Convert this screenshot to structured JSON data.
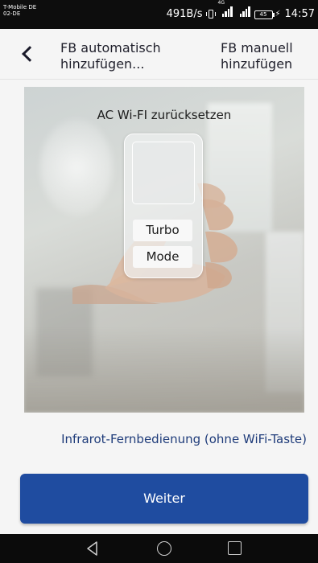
{
  "status_bar": {
    "carrier_line1": "T-Mobile DE",
    "carrier_line2": "02-DE",
    "network_speed": "491B/s",
    "network_type": "4G",
    "battery_level": "45",
    "time": "14:57",
    "icons": [
      "vibrate-icon",
      "signal-icon",
      "signal-icon",
      "battery-icon",
      "charging-icon"
    ]
  },
  "header": {
    "back_icon": "chevron-left-icon",
    "tab_auto_label": "FB automatisch hinzufügen...",
    "tab_manual_label": "FB manuell hinzufügen"
  },
  "illustration": {
    "title": "AC Wi-FI zurücksetzen",
    "remote_buttons": [
      "Turbo",
      "Mode"
    ]
  },
  "link": {
    "label": "Infrarot-Fernbedienung (ohne WiFi-Taste)"
  },
  "footer": {
    "continue_label": "Weiter"
  },
  "nav_bar": {
    "icons": [
      "nav-back-icon",
      "nav-home-icon",
      "nav-recent-icon"
    ]
  },
  "colors": {
    "primary": "#1f4ca0",
    "link": "#1f3c7a",
    "status_bar": "#0d0d0d",
    "background": "#f5f5f5"
  }
}
